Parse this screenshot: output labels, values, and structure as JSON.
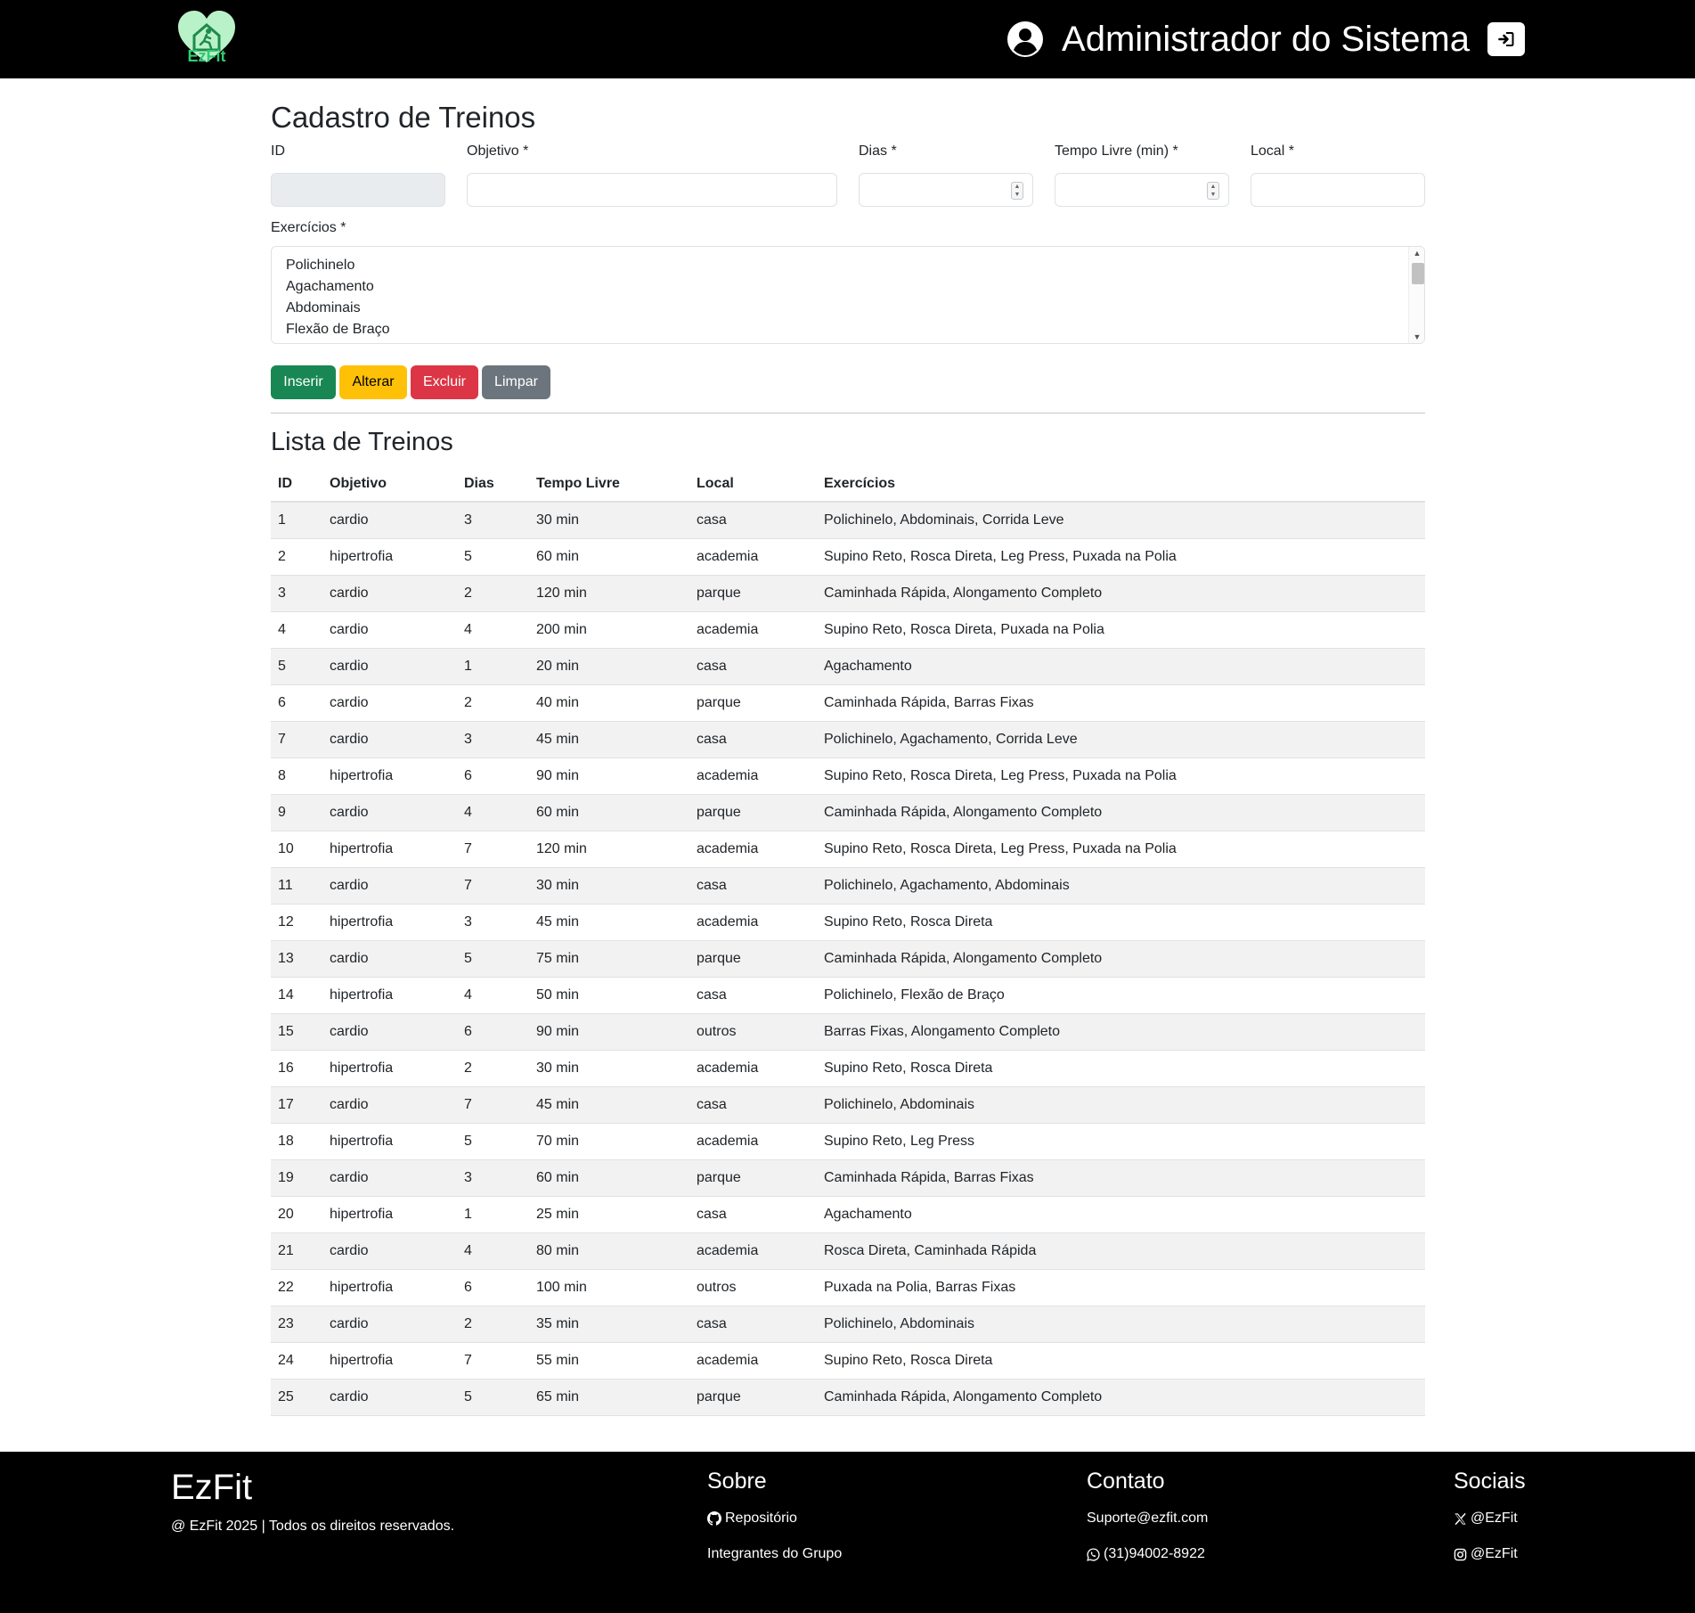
{
  "header": {
    "logo_text": "EzFit",
    "user_name": "Administrador do Sistema"
  },
  "form": {
    "title": "Cadastro de Treinos",
    "fields": {
      "id": {
        "label": "ID",
        "value": ""
      },
      "objetivo": {
        "label": "Objetivo *",
        "value": ""
      },
      "dias": {
        "label": "Dias *",
        "value": ""
      },
      "tempo_livre": {
        "label": "Tempo Livre (min) *",
        "value": ""
      },
      "local": {
        "label": "Local *",
        "value": ""
      }
    },
    "exercicios": {
      "label": "Exercícios *",
      "options": [
        "Polichinelo",
        "Agachamento",
        "Abdominais",
        "Flexão de Braço"
      ]
    },
    "buttons": {
      "inserir": "Inserir",
      "alterar": "Alterar",
      "excluir": "Excluir",
      "limpar": "Limpar"
    }
  },
  "list": {
    "title": "Lista de Treinos",
    "columns": [
      "ID",
      "Objetivo",
      "Dias",
      "Tempo Livre",
      "Local",
      "Exercícios"
    ],
    "rows": [
      [
        "1",
        "cardio",
        "3",
        "30 min",
        "casa",
        "Polichinelo, Abdominais, Corrida Leve"
      ],
      [
        "2",
        "hipertrofia",
        "5",
        "60 min",
        "academia",
        "Supino Reto, Rosca Direta, Leg Press, Puxada na Polia"
      ],
      [
        "3",
        "cardio",
        "2",
        "120 min",
        "parque",
        "Caminhada Rápida, Alongamento Completo"
      ],
      [
        "4",
        "cardio",
        "4",
        "200 min",
        "academia",
        "Supino Reto, Rosca Direta, Puxada na Polia"
      ],
      [
        "5",
        "cardio",
        "1",
        "20 min",
        "casa",
        "Agachamento"
      ],
      [
        "6",
        "cardio",
        "2",
        "40 min",
        "parque",
        "Caminhada Rápida, Barras Fixas"
      ],
      [
        "7",
        "cardio",
        "3",
        "45 min",
        "casa",
        "Polichinelo, Agachamento, Corrida Leve"
      ],
      [
        "8",
        "hipertrofia",
        "6",
        "90 min",
        "academia",
        "Supino Reto, Rosca Direta, Leg Press, Puxada na Polia"
      ],
      [
        "9",
        "cardio",
        "4",
        "60 min",
        "parque",
        "Caminhada Rápida, Alongamento Completo"
      ],
      [
        "10",
        "hipertrofia",
        "7",
        "120 min",
        "academia",
        "Supino Reto, Rosca Direta, Leg Press, Puxada na Polia"
      ],
      [
        "11",
        "cardio",
        "7",
        "30 min",
        "casa",
        "Polichinelo, Agachamento, Abdominais"
      ],
      [
        "12",
        "hipertrofia",
        "3",
        "45 min",
        "academia",
        "Supino Reto, Rosca Direta"
      ],
      [
        "13",
        "cardio",
        "5",
        "75 min",
        "parque",
        "Caminhada Rápida, Alongamento Completo"
      ],
      [
        "14",
        "hipertrofia",
        "4",
        "50 min",
        "casa",
        "Polichinelo, Flexão de Braço"
      ],
      [
        "15",
        "cardio",
        "6",
        "90 min",
        "outros",
        "Barras Fixas, Alongamento Completo"
      ],
      [
        "16",
        "hipertrofia",
        "2",
        "30 min",
        "academia",
        "Supino Reto, Rosca Direta"
      ],
      [
        "17",
        "cardio",
        "7",
        "45 min",
        "casa",
        "Polichinelo, Abdominais"
      ],
      [
        "18",
        "hipertrofia",
        "5",
        "70 min",
        "academia",
        "Supino Reto, Leg Press"
      ],
      [
        "19",
        "cardio",
        "3",
        "60 min",
        "parque",
        "Caminhada Rápida, Barras Fixas"
      ],
      [
        "20",
        "hipertrofia",
        "1",
        "25 min",
        "casa",
        "Agachamento"
      ],
      [
        "21",
        "cardio",
        "4",
        "80 min",
        "academia",
        "Rosca Direta, Caminhada Rápida"
      ],
      [
        "22",
        "hipertrofia",
        "6",
        "100 min",
        "outros",
        "Puxada na Polia, Barras Fixas"
      ],
      [
        "23",
        "cardio",
        "2",
        "35 min",
        "casa",
        "Polichinelo, Abdominais"
      ],
      [
        "24",
        "hipertrofia",
        "7",
        "55 min",
        "academia",
        "Supino Reto, Rosca Direta"
      ],
      [
        "25",
        "cardio",
        "5",
        "65 min",
        "parque",
        "Caminhada Rápida, Alongamento Completo"
      ]
    ]
  },
  "footer": {
    "brand": "EzFit",
    "copyright": "@ EzFit 2025 | Todos os direitos reservados.",
    "sobre": {
      "title": "Sobre",
      "repositorio": "Repositório",
      "integrantes": "Integrantes do Grupo"
    },
    "contato": {
      "title": "Contato",
      "email": "Suporte@ezfit.com",
      "phone": "(31)94002-8922"
    },
    "sociais": {
      "title": "Sociais",
      "x": "@EzFit",
      "instagram": "@EzFit"
    }
  },
  "colors": {
    "brand_green": "#2ecc71",
    "logo_heart": "#b9f2c9",
    "btn_inserir": "#198754",
    "btn_alterar": "#ffc107",
    "btn_excluir": "#dc3545",
    "btn_limpar": "#6c757d"
  },
  "icons": {
    "user": "user-circle-icon",
    "logout": "sign-in-icon",
    "repositorio": "github-icon",
    "phone": "whatsapp-icon",
    "x": "x-twitter-icon",
    "instagram": "instagram-icon"
  }
}
